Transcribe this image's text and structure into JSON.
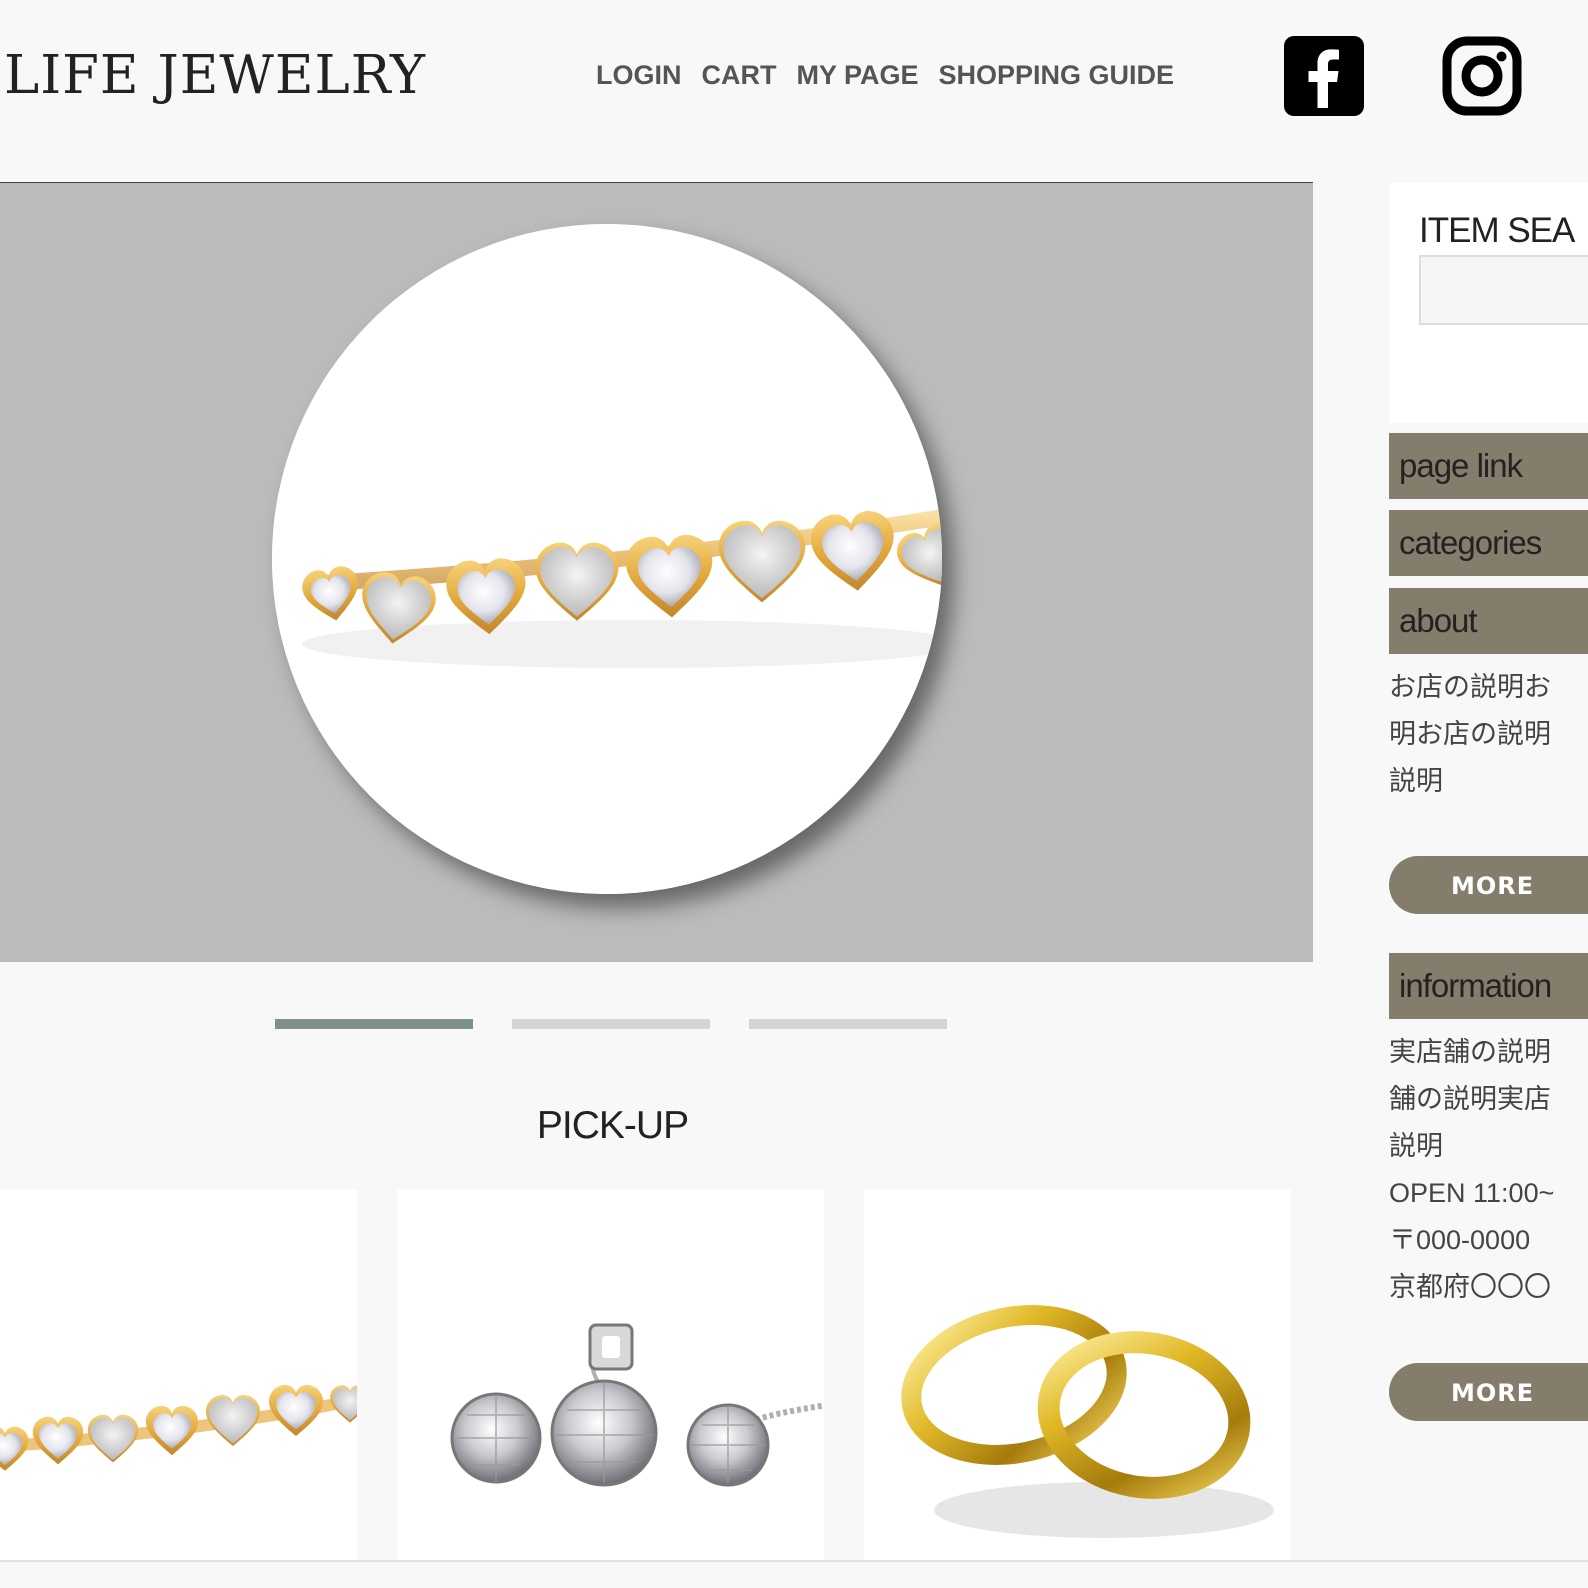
{
  "header": {
    "logo": "LIFE JEWELRY",
    "nav": [
      "LOGIN",
      "CART",
      "MY PAGE",
      "SHOPPING GUIDE"
    ],
    "social": [
      "facebook-icon",
      "instagram-icon"
    ]
  },
  "slider": {
    "active_index": 0,
    "count": 3
  },
  "pickup": {
    "title": "PICK-UP"
  },
  "sidebar": {
    "search_title": "ITEM SEA",
    "page_link": "page link",
    "categories": "categories",
    "about": {
      "title": "about",
      "lines": [
        "お店の説明お",
        "明お店の説明",
        "説明"
      ],
      "more": "MORE"
    },
    "information": {
      "title": "information",
      "lines": [
        "実店舗の説明",
        "舗の説明実店",
        "説明",
        "OPEN 11:00~",
        "〒000-0000",
        "京都府〇〇〇"
      ],
      "more": "MORE"
    }
  },
  "colors": {
    "accent": "#847d6b",
    "active_dot": "#7d9188",
    "hero_bg": "#bbbbbb"
  }
}
